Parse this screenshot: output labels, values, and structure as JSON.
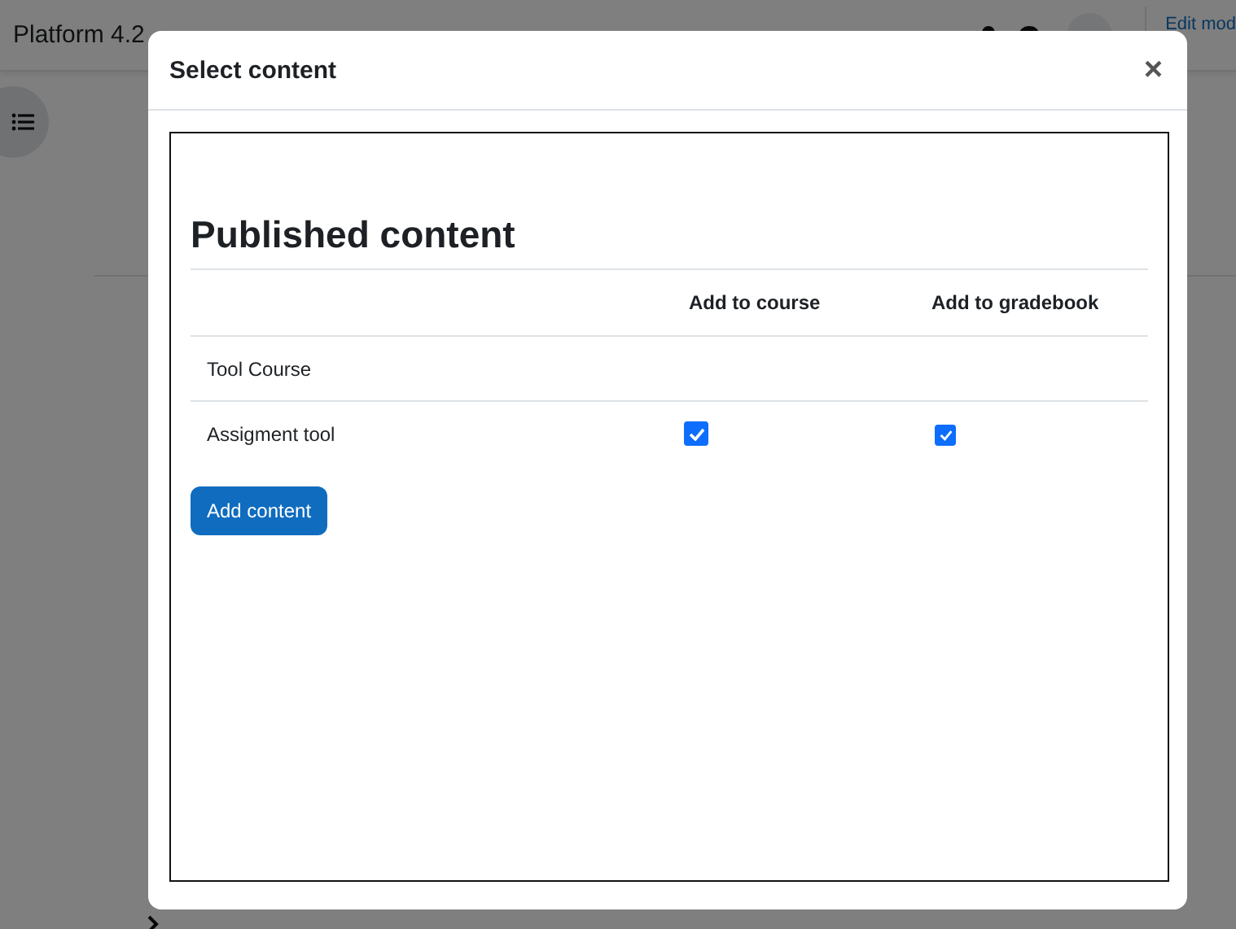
{
  "navbar": {
    "brand": "Platform 4.2",
    "edit_mode": "Edit mod"
  },
  "modal": {
    "title": "Select content",
    "close": "×",
    "content": {
      "heading": "Published content",
      "columns": [
        "Add to course",
        "Add to gradebook"
      ],
      "rows": [
        {
          "kind": "course",
          "name": "Tool Course"
        },
        {
          "kind": "tool",
          "name": "Assigment tool",
          "add_to_course": true,
          "add_to_gradebook": true
        }
      ],
      "button": "Add content"
    }
  }
}
